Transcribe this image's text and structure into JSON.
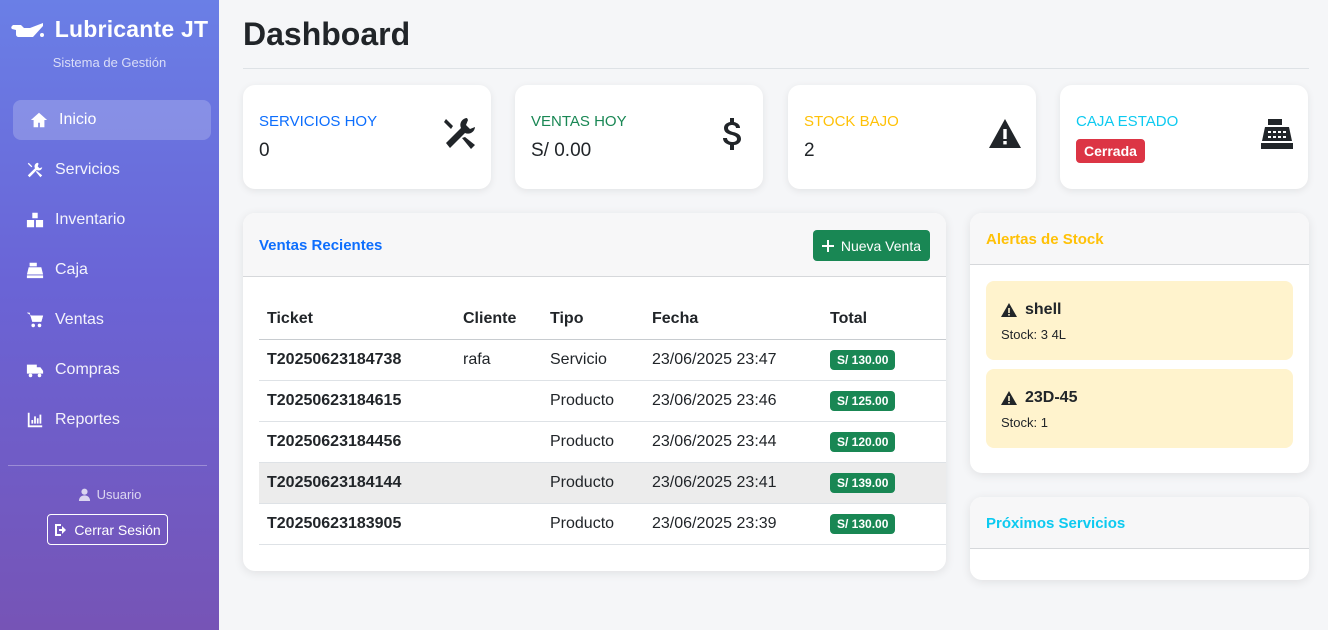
{
  "sidebar": {
    "brand": "Lubricante JT",
    "subtitle": "Sistema de Gestión",
    "items": [
      {
        "label": "Inicio"
      },
      {
        "label": "Servicios"
      },
      {
        "label": "Inventario"
      },
      {
        "label": "Caja"
      },
      {
        "label": "Ventas"
      },
      {
        "label": "Compras"
      },
      {
        "label": "Reportes"
      }
    ],
    "user": "Usuario",
    "logout": "Cerrar Sesión"
  },
  "header": {
    "title": "Dashboard"
  },
  "stats": [
    {
      "label": "SERVICIOS HOY",
      "value": "0",
      "color": "#0d6efd",
      "icon": "tools-icon"
    },
    {
      "label": "VENTAS HOY",
      "value": "S/ 0.00",
      "color": "#198754",
      "icon": "dollar-icon"
    },
    {
      "label": "STOCK BAJO",
      "value": "2",
      "color": "#ffc107",
      "icon": "warning-icon"
    },
    {
      "label": "CAJA ESTADO",
      "value": "Cerrada",
      "color": "#0dcaf0",
      "icon": "cash-register-icon"
    }
  ],
  "recent_sales": {
    "title": "Ventas Recientes",
    "new_button": "Nueva Venta",
    "columns": [
      "Ticket",
      "Cliente",
      "Tipo",
      "Fecha",
      "Total"
    ],
    "rows": [
      {
        "ticket": "T20250623184738",
        "cliente": "rafa",
        "tipo": "Servicio",
        "fecha": "23/06/2025 23:47",
        "total": "S/ 130.00"
      },
      {
        "ticket": "T20250623184615",
        "cliente": "",
        "tipo": "Producto",
        "fecha": "23/06/2025 23:46",
        "total": "S/ 125.00"
      },
      {
        "ticket": "T20250623184456",
        "cliente": "",
        "tipo": "Producto",
        "fecha": "23/06/2025 23:44",
        "total": "S/ 120.00"
      },
      {
        "ticket": "T20250623184144",
        "cliente": "",
        "tipo": "Producto",
        "fecha": "23/06/2025 23:41",
        "total": "S/ 139.00"
      },
      {
        "ticket": "T20250623183905",
        "cliente": "",
        "tipo": "Producto",
        "fecha": "23/06/2025 23:39",
        "total": "S/ 130.00"
      }
    ]
  },
  "stock_alerts": {
    "title": "Alertas de Stock",
    "color": "#ffc107",
    "items": [
      {
        "name": "shell",
        "stock": "Stock: 3 4L"
      },
      {
        "name": "23D-45",
        "stock": "Stock: 1"
      }
    ]
  },
  "upcoming": {
    "title": "Próximos Servicios",
    "color": "#0dcaf0"
  }
}
